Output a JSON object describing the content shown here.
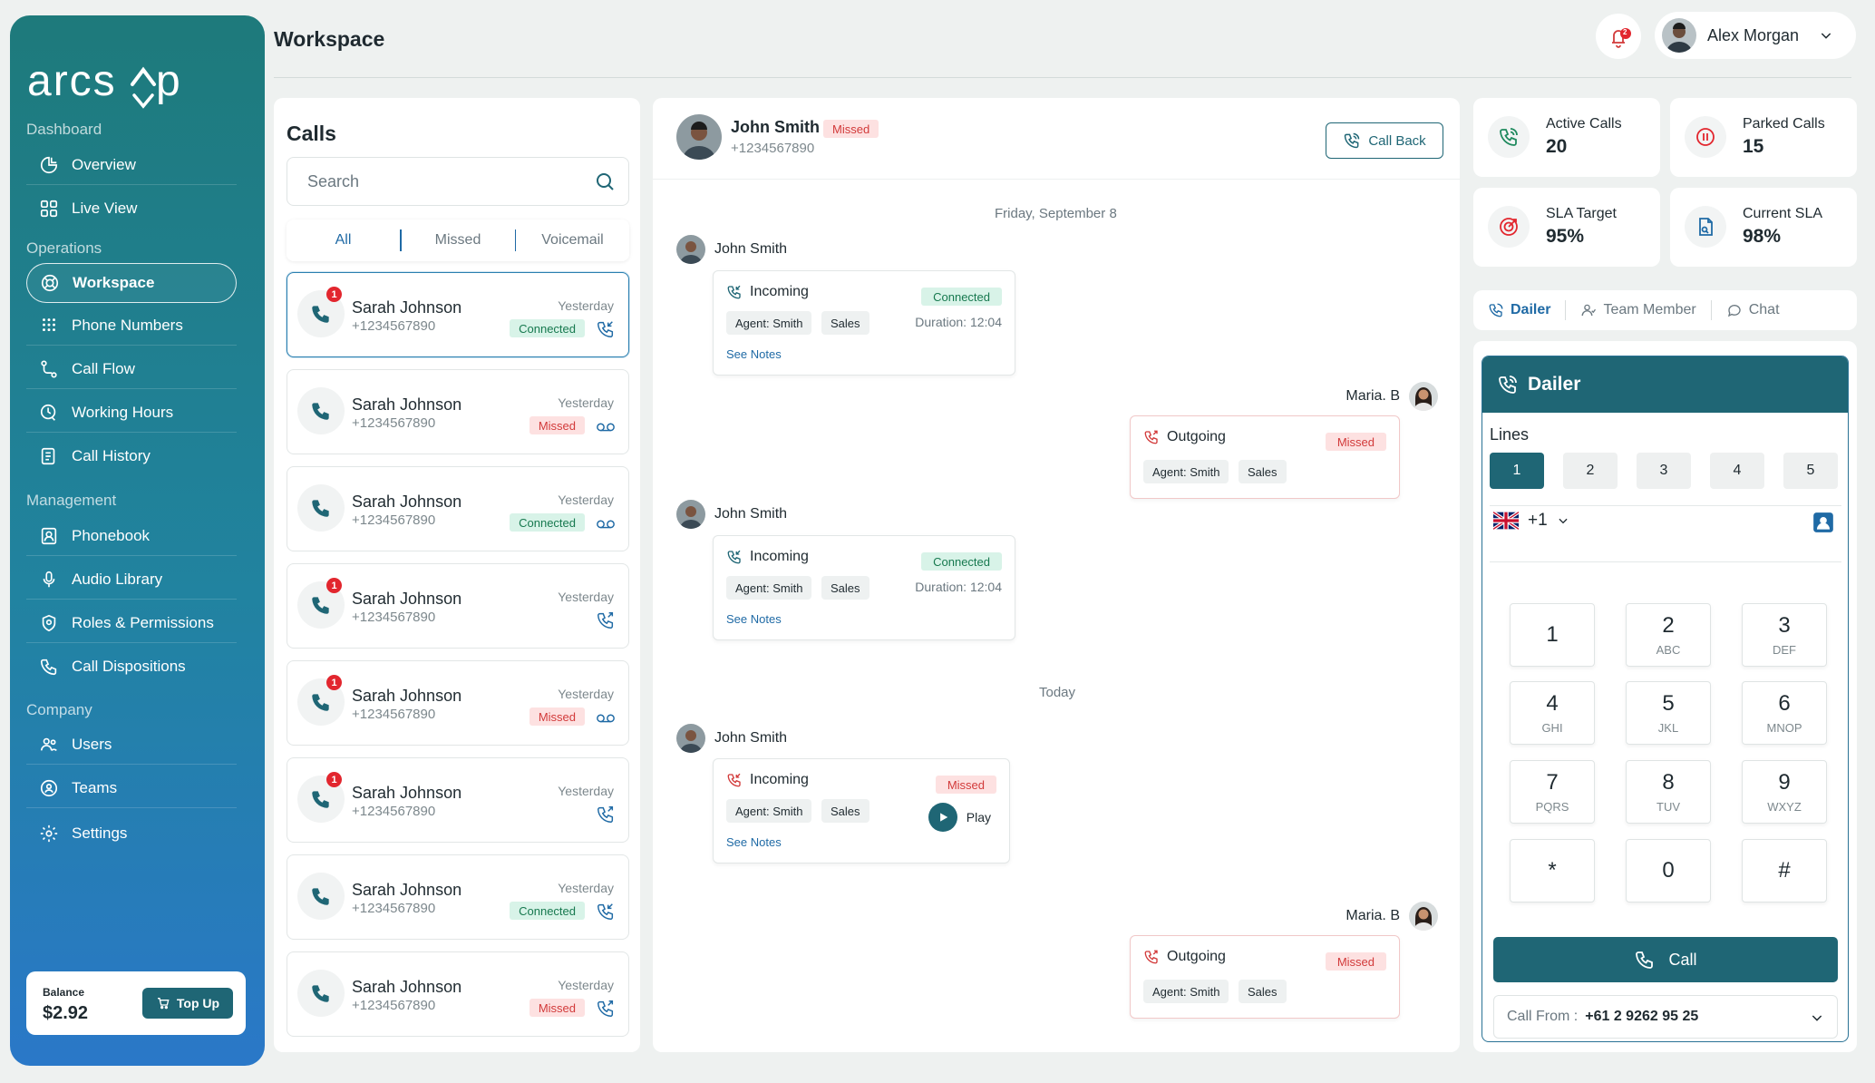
{
  "app": {
    "logo": "arcsip",
    "page_title": "Workspace"
  },
  "header": {
    "notification_count": "2",
    "user_name": "Alex Morgan"
  },
  "sidebar": {
    "sections": [
      "Dashboard",
      "Operations",
      "Management",
      "Company"
    ],
    "items": [
      {
        "label": "Overview",
        "icon": "overview-icon"
      },
      {
        "label": "Live View",
        "icon": "grid-icon"
      },
      {
        "label": "Workspace",
        "icon": "workspace-icon",
        "active": true
      },
      {
        "label": "Phone Numbers",
        "icon": "dialpad-icon"
      },
      {
        "label": "Call Flow",
        "icon": "flow-icon"
      },
      {
        "label": "Working Hours",
        "icon": "clock-icon"
      },
      {
        "label": "Call History",
        "icon": "history-icon"
      },
      {
        "label": "Phonebook",
        "icon": "phonebook-icon"
      },
      {
        "label": "Audio Library",
        "icon": "mic-icon"
      },
      {
        "label": "Roles & Permissions",
        "icon": "shield-icon"
      },
      {
        "label": "Call Dispositions",
        "icon": "phone-icon"
      },
      {
        "label": "Users",
        "icon": "users-icon"
      },
      {
        "label": "Teams",
        "icon": "teams-icon"
      },
      {
        "label": "Settings",
        "icon": "gear-icon"
      }
    ],
    "balance_label": "Balance",
    "balance_value": "$2.92",
    "topup_label": "Top Up"
  },
  "calls": {
    "title": "Calls",
    "search_placeholder": "Search",
    "filters": [
      "All",
      "Missed",
      "Voicemail"
    ],
    "active_filter": "All",
    "items": [
      {
        "name": "Sarah Johnson",
        "phone": "+1234567890",
        "date": "Yesterday",
        "status": "Connected",
        "badge": "1",
        "icon": "incoming-icon"
      },
      {
        "name": "Sarah Johnson",
        "phone": "+1234567890",
        "date": "Yesterday",
        "status": "Missed",
        "badge": "",
        "icon": "voicemail-icon"
      },
      {
        "name": "Sarah Johnson",
        "phone": "+1234567890",
        "date": "Yesterday",
        "status": "Connected",
        "badge": "",
        "icon": "voicemail-icon"
      },
      {
        "name": "Sarah Johnson",
        "phone": "+1234567890",
        "date": "Yesterday",
        "status": "",
        "badge": "1",
        "icon": "outgoing-icon"
      },
      {
        "name": "Sarah Johnson",
        "phone": "+1234567890",
        "date": "Yesterday",
        "status": "Missed",
        "badge": "1",
        "icon": "voicemail-icon"
      },
      {
        "name": "Sarah Johnson",
        "phone": "+1234567890",
        "date": "Yesterday",
        "status": "",
        "badge": "1",
        "icon": "outgoing-icon"
      },
      {
        "name": "Sarah Johnson",
        "phone": "+1234567890",
        "date": "Yesterday",
        "status": "Connected",
        "badge": "",
        "icon": "incoming-icon"
      },
      {
        "name": "Sarah Johnson",
        "phone": "+1234567890",
        "date": "Yesterday",
        "status": "Missed",
        "badge": "",
        "icon": "outgoing-icon"
      }
    ]
  },
  "conversation": {
    "contact_name": "John Smith",
    "contact_status": "Missed",
    "contact_phone": "+1234567890",
    "call_back_label": "Call Back",
    "day1": "Friday, September 8",
    "day2": "Today",
    "messages": [
      {
        "sender": "John Smith",
        "direction": "Incoming",
        "agent": "Agent: Smith",
        "dept": "Sales",
        "status": "Connected",
        "duration": "Duration: 12:04",
        "notes": "See Notes"
      },
      {
        "sender": "Maria. B",
        "direction": "Outgoing",
        "agent": "Agent: Smith",
        "dept": "Sales",
        "status": "Missed"
      },
      {
        "sender": "John Smith",
        "direction": "Incoming",
        "agent": "Agent: Smith",
        "dept": "Sales",
        "status": "Connected",
        "duration": "Duration: 12:04",
        "notes": "See Notes"
      },
      {
        "sender": "John Smith",
        "direction": "Incoming",
        "agent": "Agent: Smith",
        "dept": "Sales",
        "status": "Missed",
        "play": "Play",
        "notes": "See Notes"
      },
      {
        "sender": "Maria. B",
        "direction": "Outgoing",
        "agent": "Agent: Smith",
        "dept": "Sales",
        "status": "Missed"
      }
    ]
  },
  "stats": [
    {
      "label": "Active Calls",
      "value": "20",
      "icon": "phone-icon",
      "color": "#1f8a5e"
    },
    {
      "label": "Parked Calls",
      "value": "15",
      "icon": "pause-icon",
      "color": "#e2262e"
    },
    {
      "label": "SLA Target",
      "value": "95%",
      "icon": "target-icon",
      "color": "#e2262e"
    },
    {
      "label": "Current SLA",
      "value": "98%",
      "icon": "document-icon",
      "color": "#1f6aa5"
    }
  ],
  "right_tabs": [
    "Dailer",
    "Team Member",
    "Chat"
  ],
  "dialer": {
    "title": "Dailer",
    "lines_label": "Lines",
    "lines": [
      "1",
      "2",
      "3",
      "4",
      "5"
    ],
    "active_line": "1",
    "country_code": "+1",
    "keys": [
      {
        "digit": "1",
        "letters": ""
      },
      {
        "digit": "2",
        "letters": "ABC"
      },
      {
        "digit": "3",
        "letters": "DEF"
      },
      {
        "digit": "4",
        "letters": "GHI"
      },
      {
        "digit": "5",
        "letters": "JKL"
      },
      {
        "digit": "6",
        "letters": "MNOP"
      },
      {
        "digit": "7",
        "letters": "PQRS"
      },
      {
        "digit": "8",
        "letters": "TUV"
      },
      {
        "digit": "9",
        "letters": "WXYZ"
      },
      {
        "digit": "*",
        "letters": ""
      },
      {
        "digit": "0",
        "letters": ""
      },
      {
        "digit": "#",
        "letters": ""
      }
    ],
    "call_label": "Call",
    "call_from_label": "Call From :",
    "call_from_number": "+61 2 9262 95 25"
  },
  "colors": {
    "primary": "#1f6675",
    "accent_blue": "#1f6aa5",
    "missed": "#d23a3a",
    "connected": "#17794f"
  }
}
